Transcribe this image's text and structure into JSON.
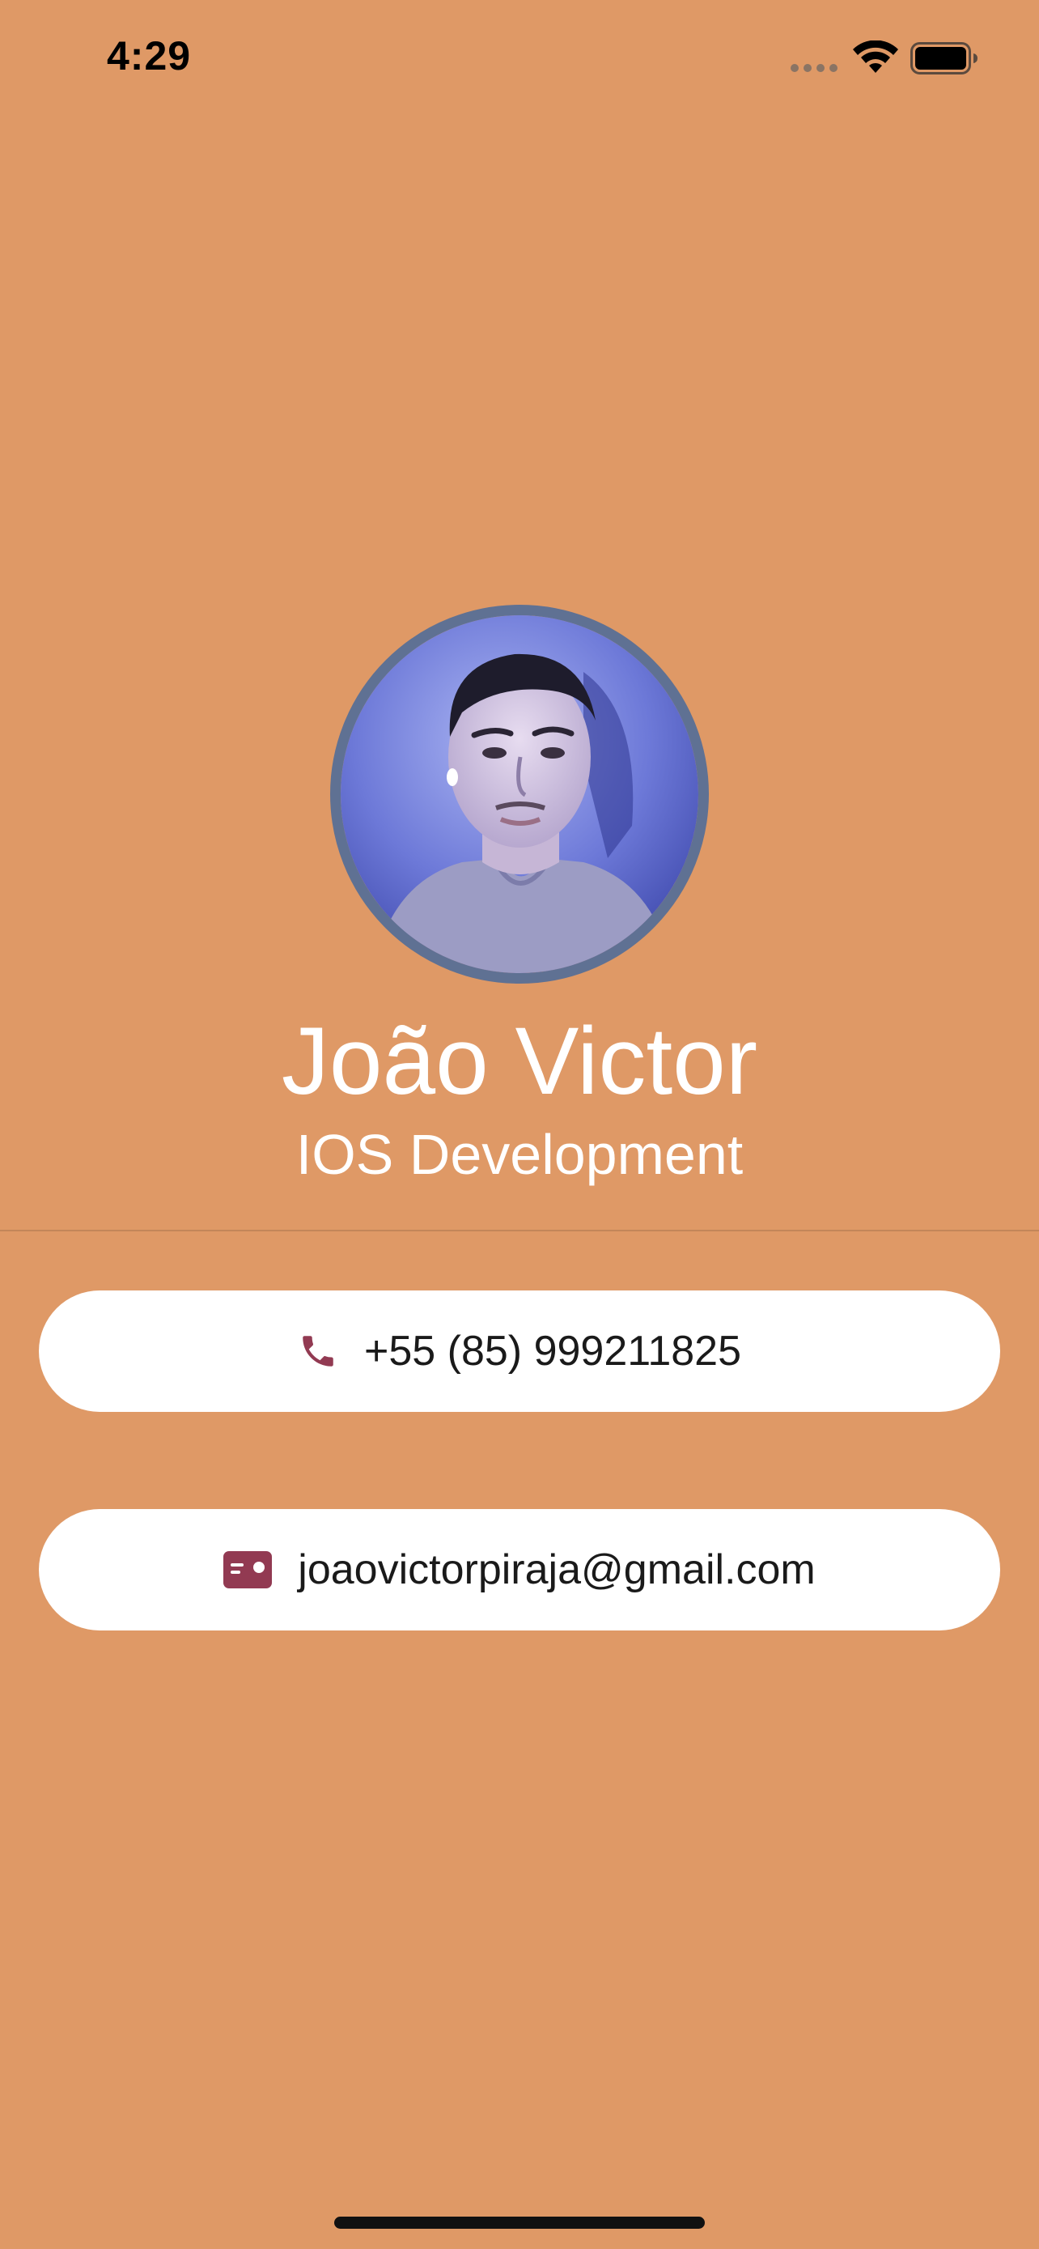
{
  "colors": {
    "background": "#df9966",
    "card": "#ffffff",
    "icon_accent": "#923a52",
    "avatar_border": "#5f7193",
    "text_primary": "#ffffff",
    "card_text": "#1a1a1a"
  },
  "status_bar": {
    "time": "4:29",
    "icons": [
      "cellular-signal-icon",
      "wifi-icon",
      "battery-icon"
    ]
  },
  "profile": {
    "name": "João Victor",
    "role": "IOS Development",
    "avatar_icon": "profile-photo"
  },
  "contacts": {
    "phone": {
      "icon": "phone-icon",
      "value": "+55 (85) 999211825"
    },
    "email": {
      "icon": "contact-card-icon",
      "value": "joaovictorpiraja@gmail.com"
    }
  }
}
